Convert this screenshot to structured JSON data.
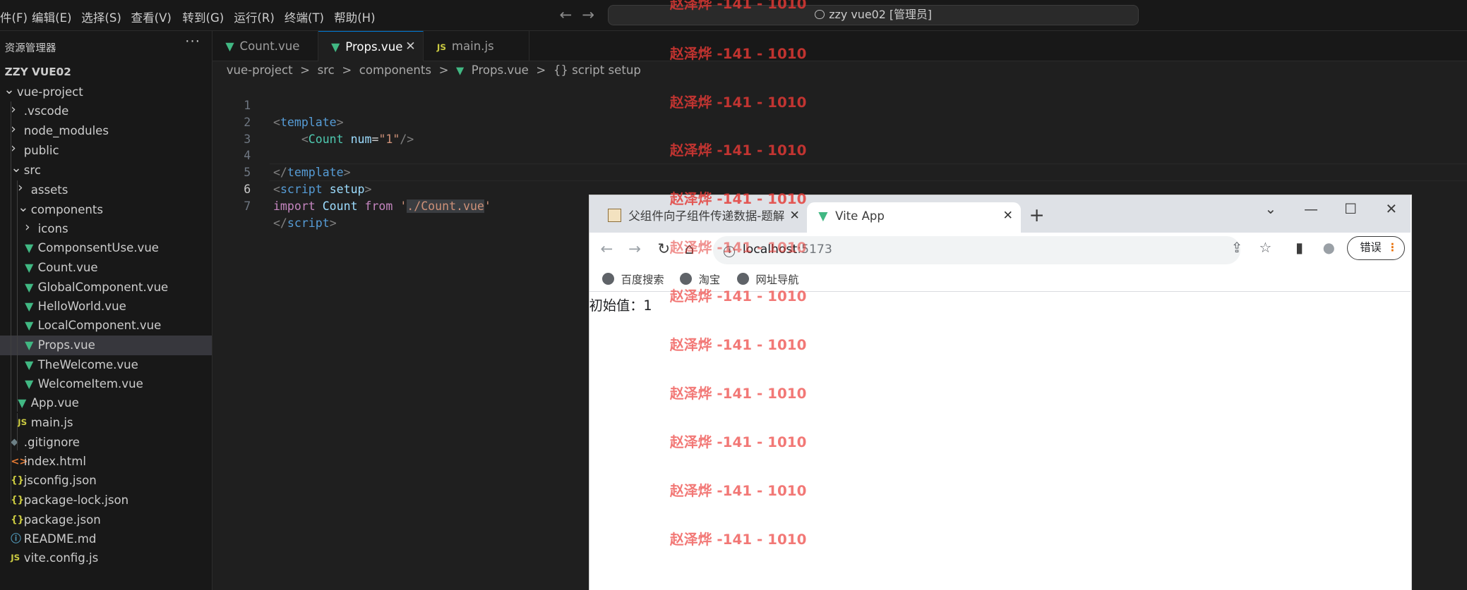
{
  "menubar": {
    "items": [
      "件(F)",
      "编辑(E)",
      "选择(S)",
      "查看(V)",
      "转到(G)",
      "运行(R)",
      "终端(T)",
      "帮助(H)"
    ],
    "back_icon": "arrow-left-icon",
    "forward_icon": "arrow-right-icon",
    "command_center": "zzy vue02 [管理员]"
  },
  "sidebar": {
    "title": "资源管理器",
    "more_label": "···",
    "root": "ZZY VUE02",
    "tree": [
      {
        "label": "vue-project",
        "icon": "chevron-down-icon",
        "glyph": "⌄"
      },
      {
        "label": ".vscode",
        "icon": "chevron-right-icon",
        "glyph": "›"
      },
      {
        "label": "node_modules",
        "icon": "chevron-right-icon",
        "glyph": "›"
      },
      {
        "label": "public",
        "icon": "chevron-right-icon",
        "glyph": "›"
      },
      {
        "label": "src",
        "icon": "chevron-down-icon",
        "glyph": "⌄"
      },
      {
        "label": "assets",
        "icon": "chevron-right-icon",
        "glyph": "›"
      },
      {
        "label": "components",
        "icon": "chevron-down-icon",
        "glyph": "⌄"
      },
      {
        "label": "icons",
        "icon": "chevron-right-icon",
        "glyph": "›"
      },
      {
        "label": "ComponsentUse.vue",
        "icon": "vue-file-icon",
        "glyph": "▼"
      },
      {
        "label": "Count.vue",
        "icon": "vue-file-icon",
        "glyph": "▼"
      },
      {
        "label": "GlobalComponent.vue",
        "icon": "vue-file-icon",
        "glyph": "▼"
      },
      {
        "label": "HelloWorld.vue",
        "icon": "vue-file-icon",
        "glyph": "▼"
      },
      {
        "label": "LocalComponent.vue",
        "icon": "vue-file-icon",
        "glyph": "▼"
      },
      {
        "label": "Props.vue",
        "icon": "vue-file-icon",
        "glyph": "▼",
        "selected": true
      },
      {
        "label": "TheWelcome.vue",
        "icon": "vue-file-icon",
        "glyph": "▼"
      },
      {
        "label": "WelcomeItem.vue",
        "icon": "vue-file-icon",
        "glyph": "▼"
      },
      {
        "label": "App.vue",
        "icon": "vue-file-icon",
        "glyph": "▼"
      },
      {
        "label": "main.js",
        "icon": "js-file-icon",
        "glyph": "JS"
      },
      {
        "label": ".gitignore",
        "icon": "git-file-icon",
        "glyph": "◆"
      },
      {
        "label": "index.html",
        "icon": "html-file-icon",
        "glyph": "<>"
      },
      {
        "label": "jsconfig.json",
        "icon": "json-file-icon",
        "glyph": "{}"
      },
      {
        "label": "package-lock.json",
        "icon": "json-file-icon",
        "glyph": "{}"
      },
      {
        "label": "package.json",
        "icon": "json-file-icon",
        "glyph": "{}"
      },
      {
        "label": "README.md",
        "icon": "info-icon",
        "glyph": "ⓘ"
      },
      {
        "label": "vite.config.js",
        "icon": "js-file-icon",
        "glyph": "JS"
      }
    ]
  },
  "editor_tabs": [
    {
      "label": "Count.vue",
      "icon": "vue-file-icon",
      "glyph": "▼"
    },
    {
      "label": "Props.vue",
      "icon": "vue-file-icon",
      "glyph": "▼",
      "active": true,
      "close": "✕"
    },
    {
      "label": "main.js",
      "icon": "js-file-icon",
      "glyph": "JS"
    }
  ],
  "breadcrumb": [
    "vue-project",
    ">",
    "src",
    ">",
    "components",
    ">",
    "Props.vue",
    ">",
    "{} script setup"
  ],
  "editor": {
    "line_numbers": [
      "1",
      "2",
      "3",
      "4",
      "5",
      "6",
      "7"
    ],
    "current_line": "6",
    "tokens": {
      "l1_open": "<",
      "l1_tag": "template",
      "l1_close": ">",
      "l2_indent": "    ",
      "l2_open": "<",
      "l2_comp": "Count",
      "l2_attr": "num",
      "l2_eq": "=",
      "l2_val": "\"1\"",
      "l2_close": "/>",
      "l4_open": "</",
      "l4_tag": "template",
      "l4_close": ">",
      "l5_open": "<",
      "l5_tag": "script",
      "l5_attr": "setup",
      "l5_close": ">",
      "l6_kw_import": "import",
      "l6_name": "Count",
      "l6_kw_from": "from",
      "l6_q1": "'",
      "l6_path": "./Count.vue",
      "l6_q2": "'",
      "l7_open": "</",
      "l7_tag": "script",
      "l7_close": ">"
    }
  },
  "browser": {
    "tabs": [
      {
        "label": "父组件向子组件传递数据-题解",
        "close": "✕"
      },
      {
        "label": "Vite App",
        "close": "✕",
        "active": true
      }
    ],
    "new_tab": "+",
    "window_controls": {
      "dropdown": "⌄",
      "minimize": "—",
      "maximize": "☐",
      "close": "✕"
    },
    "nav": {
      "back": "←",
      "forward": "→",
      "reload": "↻",
      "home": "⌂"
    },
    "address": {
      "host": "localhost",
      "port": ":5173",
      "info_glyph": "i"
    },
    "toolbar_icons": {
      "share": "⇪",
      "star": "☆",
      "sidepanel": "▮",
      "profile": "●"
    },
    "error_button": "错误",
    "error_dots": "⋮",
    "bookmarks": [
      "百度搜索",
      "淘宝",
      "网址导航"
    ],
    "page_text": "初始值：1"
  },
  "watermark": "赵泽烨 -141 - 1010",
  "colors": {
    "vscode_bg": "#1f1f1f",
    "sidebar_bg": "#181818",
    "accent": "#0078d4",
    "vue_green": "#41b883",
    "watermark_red": "#e53935"
  }
}
